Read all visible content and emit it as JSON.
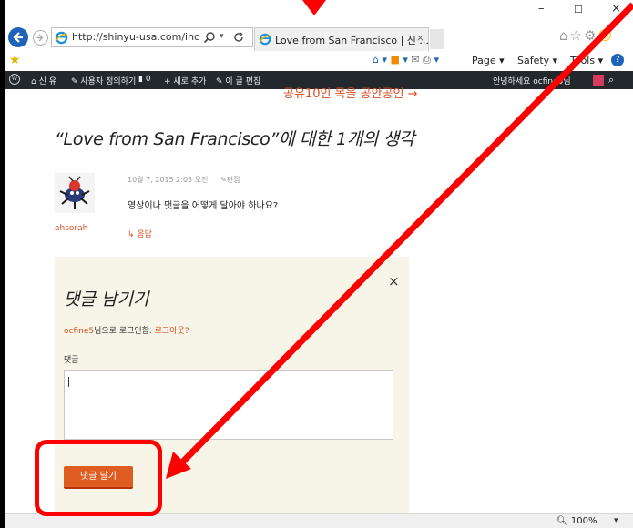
{
  "browser": {
    "address_url": "http://shinyu-usa.com/inc",
    "tab_title": "Love from San Francisco | 신 ...",
    "tab_close": "×",
    "win_min": "–",
    "win_max": "☐",
    "win_close": "×",
    "command_bar": {
      "page_label": "Page ▾",
      "safety_label": "Safety ▾",
      "tools_label": "Tools ▾",
      "help_label": "?"
    },
    "zoom_label": "100%"
  },
  "admin_bar": {
    "site_label": "신 유",
    "customize_label": "사용자 정의하기",
    "comments_count": "0",
    "new_label": "+ 새로 추가",
    "edit_label": "이 글 편집",
    "howdy_label": "안녕하세요 ocfine5님"
  },
  "post": {
    "prev_link": "공유10인 목을 공안공인 →",
    "comments_heading": "“Love from San Francisco”에 대한 1개의 생각",
    "comment": {
      "author": "ahsorah",
      "date": "10월 7, 2015 2:05 오전",
      "edit_label": "편집",
      "text": "영상이나 댓글을 어떻게 달아야 하나요?",
      "reply_label": "응답"
    }
  },
  "respond": {
    "title": "댓글 남기기",
    "close_label": "×",
    "logged_in_user": "ocfine5",
    "logged_in_mid": "님으로 로그인함. ",
    "logout_label": "로그아웃?",
    "comment_label": "댓글",
    "comment_value": "",
    "submit_label": "댓글 달기"
  },
  "annotation_color": "#ff0000"
}
